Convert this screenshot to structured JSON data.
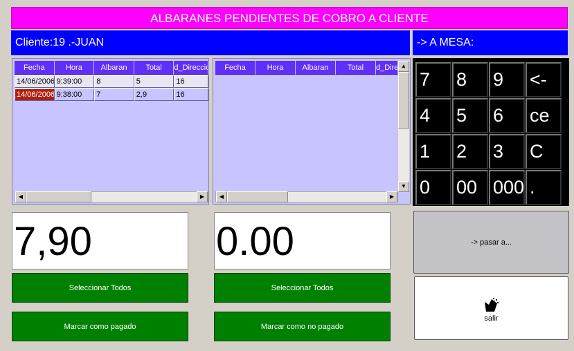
{
  "title": "ALBARANES PENDIENTES DE COBRO A CLIENTE",
  "cliente_label": "Cliente:19 .-JUAN",
  "mesa_label": "-> A MESA:",
  "colors": {
    "title_bg": "#ff00ff",
    "bar_bg": "#0000ff",
    "grid_header": "#6030f8",
    "grid_bg": "#c8c4ff",
    "button_green": "#008000",
    "selected_cell": "#b02010"
  },
  "grid_left": {
    "columns": [
      "Fecha",
      "Hora",
      "Albaran",
      "Total",
      "d_Direccion"
    ],
    "rows": [
      [
        "14/06/2006",
        "9:39:00",
        "8",
        "5",
        "16"
      ],
      [
        "14/06/2006",
        "9:38:00",
        "7",
        "2,9",
        "16"
      ]
    ]
  },
  "grid_right": {
    "columns": [
      "Fecha",
      "Hora",
      "Albaran",
      "Total",
      "d_Direccion"
    ],
    "rows": []
  },
  "keypad": [
    "7",
    "8",
    "9",
    "<-",
    "4",
    "5",
    "6",
    "ce",
    "1",
    "2",
    "3",
    "C",
    "0",
    "00",
    "000",
    "."
  ],
  "total_left": "7,90",
  "total_right": "0.00",
  "buttons": {
    "select_all_left": "Seleccionar Todos",
    "mark_paid": "Marcar como pagado",
    "select_all_right": "Seleccionar Todos",
    "mark_unpaid": "Marcar como no pagado",
    "pasar": "-> pasar a...",
    "salir": "salir"
  }
}
